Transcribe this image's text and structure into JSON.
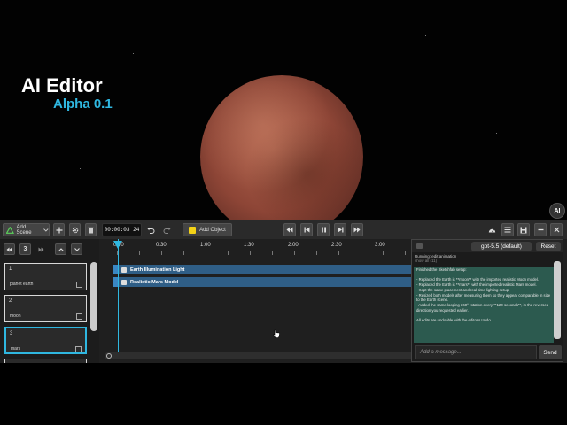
{
  "overlay": {
    "title": "AI Editor",
    "version": "Alpha 0.1",
    "ai_badge": "AI"
  },
  "toolbar": {
    "add_scene": "Add Scene",
    "time": "00:00:03 24",
    "add_object": "Add Object",
    "icons": [
      "triangle-scene-icon",
      "plus-icon",
      "gear-icon",
      "trash-icon",
      "undo-icon",
      "redo-icon",
      "cube-icon",
      "skip-back-icon",
      "step-back-icon",
      "pause-icon",
      "step-forward-icon",
      "skip-forward-icon",
      "speed-gauge-icon",
      "menu-icon",
      "save-icon",
      "minimize-icon",
      "close-icon"
    ]
  },
  "timeline": {
    "current_scene_number": "3",
    "ruler_ticks": [
      "0:00",
      "0:30",
      "1:00",
      "1:30",
      "2:00",
      "2:30",
      "3:00"
    ],
    "scenes": [
      {
        "number": "1",
        "name": "planet earth"
      },
      {
        "number": "2",
        "name": "moon"
      },
      {
        "number": "3",
        "name": "mars"
      }
    ],
    "clips": [
      "Earth Illumination Light",
      "Realistic Mars Model"
    ]
  },
  "chat": {
    "model": "gpt-5.5 (default)",
    "reset": "Reset",
    "running": "Running: edit animation",
    "running_sub": "show all (11)",
    "message_lines": [
      "Finished the Sketchfab setup:",
      "",
      "- Replaced the Earth is **moon** with the imported realistic Moon model.",
      "- Replaced the Earth is **mars** with the imported realistic Mars model.",
      "- Kept the same placement and real-time lighting setup.",
      "- Resized both models after measuring them so they appear comparable in size to the Earth scene.",
      "- Added the same looping 360° rotation every **120 seconds**, in the reversed direction you requested earlier.",
      "",
      "All edits are undoable with the editor's Undo."
    ],
    "input_placeholder": "Add a message...",
    "send": "Send"
  },
  "colors": {
    "accent": "#2fb7e0",
    "clip": "#2f5e86",
    "chat_message": "#2c5a4f",
    "cube": "#f3d217"
  }
}
